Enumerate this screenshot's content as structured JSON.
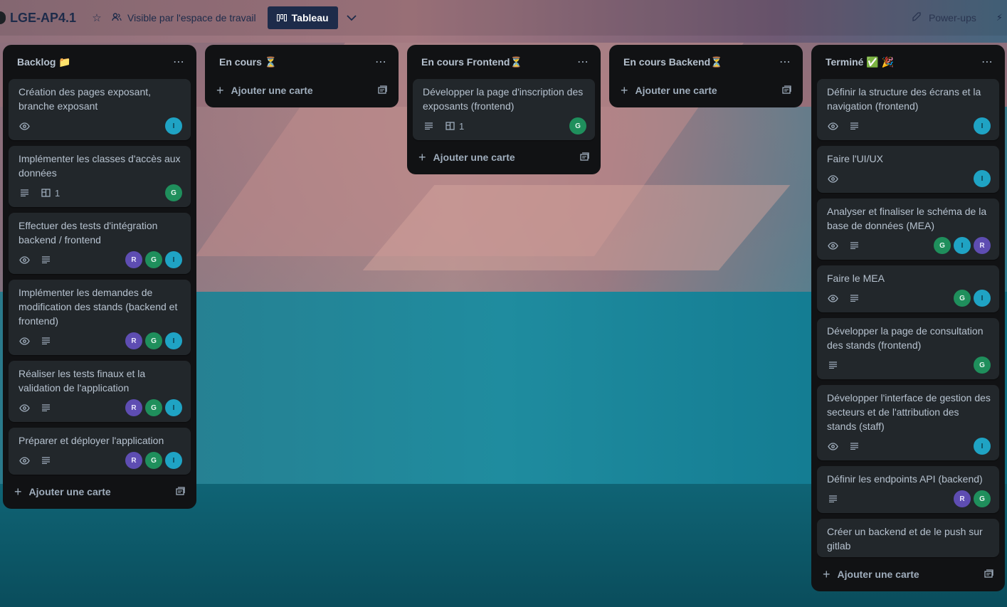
{
  "board": {
    "title": "LGE-AP4.1",
    "visibility": "Visible par l'espace de travail",
    "view_label": "Tableau",
    "powerups": "Power-ups"
  },
  "icons": {
    "star": "star-icon",
    "visibility": "users-icon",
    "view": "board-icon",
    "chevron": "chevron-down-icon",
    "powerups": "rocket-icon",
    "automation": "bolt-icon",
    "eye": "eye-icon",
    "description": "description-icon",
    "attachment": "attachment-icon",
    "plus": "plus-icon",
    "template": "template-icon",
    "menu": "more-icon"
  },
  "colors": {
    "list_bg": "#111214",
    "card_bg": "#22272b",
    "text": "#b6c2cf",
    "avatar_I": "#1fa3c4",
    "avatar_G": "#1f8f5c",
    "avatar_R": "#5e4db2"
  },
  "add_card_label": "Ajouter une carte",
  "lists": [
    {
      "title": "Backlog 📁",
      "cards": [
        {
          "title": "Création des pages exposant, branche exposant",
          "eye": true,
          "desc": false,
          "attach": "",
          "members": [
            "I"
          ]
        },
        {
          "title": "Implémenter les classes d'accès aux données",
          "eye": false,
          "desc": true,
          "attach": "1",
          "members": [
            "G"
          ]
        },
        {
          "title": "Effectuer des tests d'intégration backend / frontend",
          "eye": true,
          "desc": true,
          "attach": "",
          "members": [
            "R",
            "G",
            "I"
          ]
        },
        {
          "title": "Implémenter les demandes de modification des stands (backend et frontend)",
          "eye": true,
          "desc": true,
          "attach": "",
          "members": [
            "R",
            "G",
            "I"
          ]
        },
        {
          "title": "Réaliser les tests finaux et la validation de l'application",
          "eye": true,
          "desc": true,
          "attach": "",
          "members": [
            "R",
            "G",
            "I"
          ]
        },
        {
          "title": "Préparer et déployer l'application",
          "eye": true,
          "desc": true,
          "attach": "",
          "members": [
            "R",
            "G",
            "I"
          ]
        }
      ]
    },
    {
      "title": "En cours ⏳",
      "cards": []
    },
    {
      "title": "En cours Frontend⏳",
      "cards": [
        {
          "title": "Développer la page d'inscription des exposants (frontend)",
          "eye": false,
          "desc": true,
          "attach": "1",
          "members": [
            "G"
          ]
        }
      ]
    },
    {
      "title": "En cours Backend⏳",
      "cards": []
    },
    {
      "title": "Terminé ✅ 🎉",
      "cards": [
        {
          "title": "Définir la structure des écrans et la navigation (frontend)",
          "eye": true,
          "desc": true,
          "attach": "",
          "members": [
            "I"
          ]
        },
        {
          "title": "Faire l'UI/UX",
          "eye": true,
          "desc": false,
          "attach": "",
          "members": [
            "I"
          ]
        },
        {
          "title": "Analyser et finaliser le schéma de la base de données (MEA)",
          "eye": true,
          "desc": true,
          "attach": "",
          "members": [
            "G",
            "I",
            "R"
          ]
        },
        {
          "title": "Faire le MEA",
          "eye": true,
          "desc": true,
          "attach": "",
          "members": [
            "G",
            "I"
          ]
        },
        {
          "title": "Développer la page de consultation des stands (frontend)",
          "eye": false,
          "desc": true,
          "attach": "",
          "members": [
            "G"
          ]
        },
        {
          "title": "Développer l'interface de gestion des secteurs et de l'attribution des stands (staff)",
          "eye": true,
          "desc": true,
          "attach": "",
          "members": [
            "I"
          ]
        },
        {
          "title": "Définir les endpoints API (backend)",
          "eye": false,
          "desc": true,
          "attach": "",
          "members": [
            "R",
            "G"
          ]
        },
        {
          "title": "Créer un backend et de le push sur gitlab",
          "eye": false,
          "desc": false,
          "attach": "",
          "members": []
        }
      ]
    }
  ]
}
